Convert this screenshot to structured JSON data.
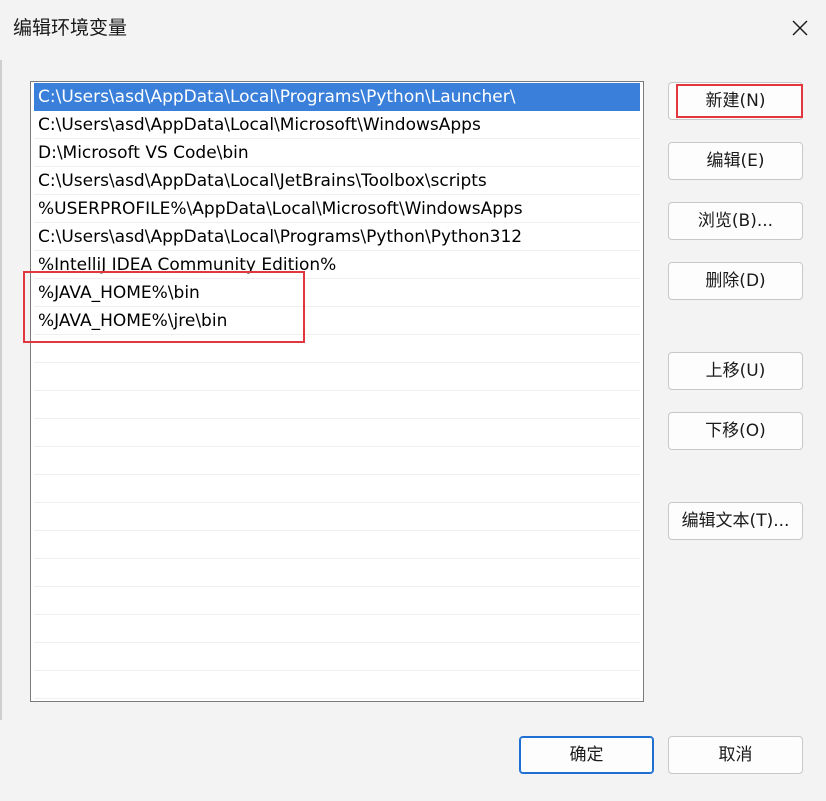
{
  "window": {
    "title": "编辑环境变量",
    "close_icon": "close-icon"
  },
  "paths": [
    "C:\\Users\\asd\\AppData\\Local\\Programs\\Python\\Launcher\\",
    "C:\\Users\\asd\\AppData\\Local\\Microsoft\\WindowsApps",
    "D:\\Microsoft VS Code\\bin",
    "C:\\Users\\asd\\AppData\\Local\\JetBrains\\Toolbox\\scripts",
    "%USERPROFILE%\\AppData\\Local\\Microsoft\\WindowsApps",
    "C:\\Users\\asd\\AppData\\Local\\Programs\\Python\\Python312",
    "%IntelliJ IDEA Community Edition%",
    "%JAVA_HOME%\\bin",
    "%JAVA_HOME%\\jre\\bin"
  ],
  "selected_index": 0,
  "buttons": {
    "new": "新建(N)",
    "edit": "编辑(E)",
    "browse": "浏览(B)...",
    "delete": "删除(D)",
    "move_up": "上移(U)",
    "move_down": "下移(O)",
    "edit_text": "编辑文本(T)...",
    "ok": "确定",
    "cancel": "取消"
  },
  "colors": {
    "selection": "#3a7fd9",
    "highlight": "#e0383e",
    "ok_border": "#1e6fd1"
  }
}
